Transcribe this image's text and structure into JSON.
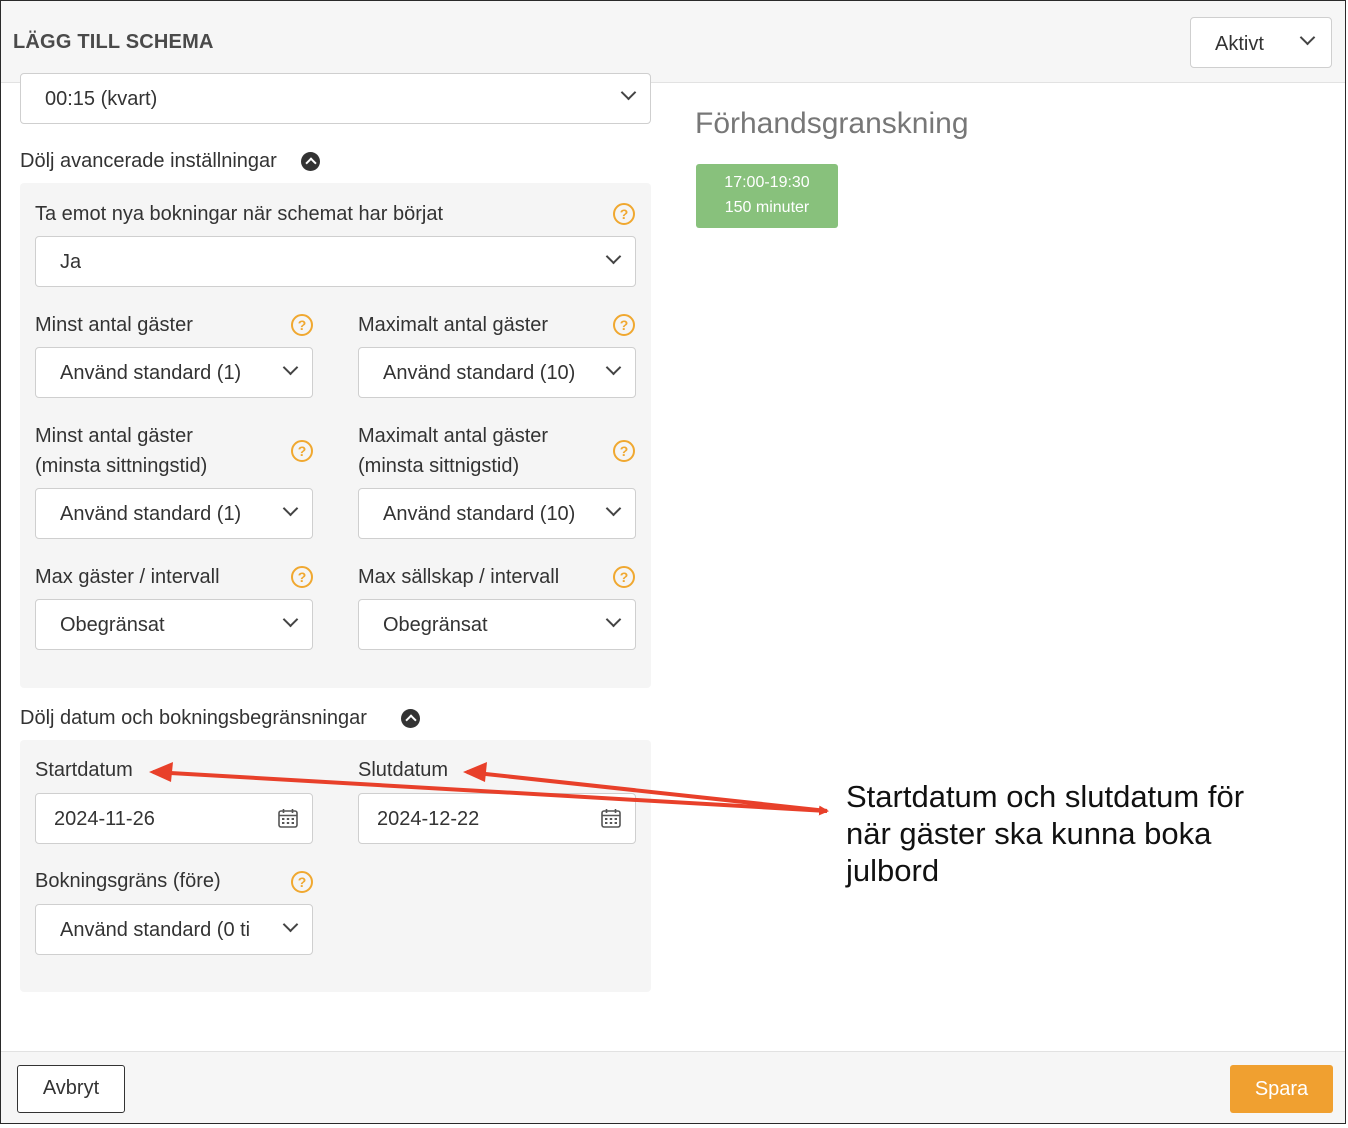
{
  "header": {
    "title": "LÄGG TILL SCHEMA",
    "status_value": "Aktivt"
  },
  "interval_select": {
    "value": "00:15 (kvart)"
  },
  "advanced": {
    "toggle_label": "Dölj avancerade inställningar",
    "accept_new_bookings": {
      "label": "Ta emot nya bokningar när schemat har börjat",
      "value": "Ja"
    },
    "min_guests": {
      "label": "Minst antal gäster",
      "value": "Använd standard (1)"
    },
    "max_guests": {
      "label": "Maximalt antal gäster",
      "value": "Använd standard (10)"
    },
    "min_guests_seating": {
      "label_line1": "Minst antal gäster",
      "label_line2": "(minsta sittningstid)",
      "value": "Använd standard (1)"
    },
    "max_guests_seating": {
      "label_line1": "Maximalt antal gäster",
      "label_line2": "(minsta sittnigstid)",
      "value": "Använd standard (10)"
    },
    "max_guests_interval": {
      "label": "Max gäster / intervall",
      "value": "Obegränsat"
    },
    "max_parties_interval": {
      "label": "Max sällskap / intervall",
      "value": "Obegränsat"
    }
  },
  "dates": {
    "toggle_label": "Dölj datum och bokningsbegränsningar",
    "start": {
      "label": "Startdatum",
      "value": "2024-11-26"
    },
    "end": {
      "label": "Slutdatum",
      "value": "2024-12-22"
    },
    "booking_limit": {
      "label": "Bokningsgräns (före)",
      "value": "Använd standard (0 ti"
    }
  },
  "preview": {
    "title": "Förhandsgranskning",
    "slot_time": "17:00-19:30",
    "slot_duration": "150 minuter"
  },
  "annotation": {
    "text": "Startdatum och slutdatum för när gäster ska kunna boka julbord",
    "arrow_color": "#e8402a"
  },
  "footer": {
    "cancel_label": "Avbryt",
    "save_label": "Spara"
  },
  "colors": {
    "accent": "#f0a030",
    "slot_green": "#88c17c",
    "help_icon": "#f0a830"
  }
}
